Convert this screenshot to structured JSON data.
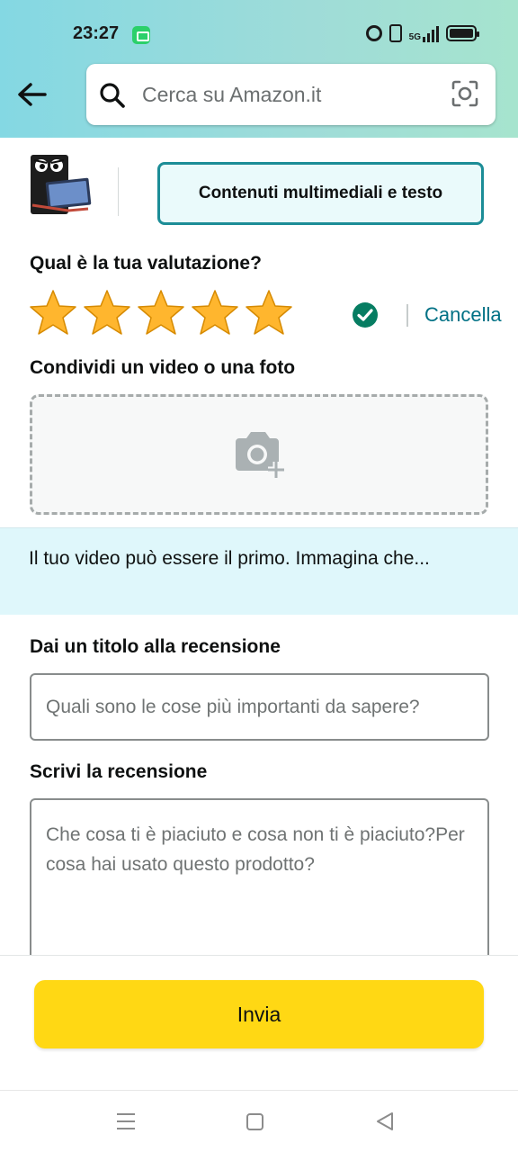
{
  "status_bar": {
    "time": "23:27",
    "network": "5G"
  },
  "header": {
    "search_placeholder": "Cerca su Amazon.it",
    "back_icon": "arrow-left-icon",
    "camera_icon": "camera-scan-icon"
  },
  "product": {
    "thumbnail_icon": "product-thumbnail",
    "media_button_label": "Contenuti multimediali e testo"
  },
  "rating": {
    "title": "Qual è la tua valutazione?",
    "stars_selected": 5,
    "stars_total": 5,
    "cancel_label": "Cancella"
  },
  "media": {
    "title": "Condividi un video o una foto",
    "upload_icon": "camera-plus-icon"
  },
  "promo": {
    "text": "Il tuo video può essere il primo. Immagina che..."
  },
  "review_title": {
    "label": "Dai un titolo alla recensione",
    "placeholder": "Quali sono le cose più importanti da sapere?"
  },
  "review_body": {
    "label": "Scrivi la recensione",
    "placeholder": "Che cosa ti è piaciuto e cosa non ti è piaciuto?Per cosa hai usato questo prodotto?"
  },
  "submit": {
    "label": "Invia"
  },
  "colors": {
    "accent_teal": "#1c8d97",
    "link": "#007185",
    "button_yellow": "#ffd814",
    "star": "#ffa41c",
    "check": "#067d62"
  }
}
